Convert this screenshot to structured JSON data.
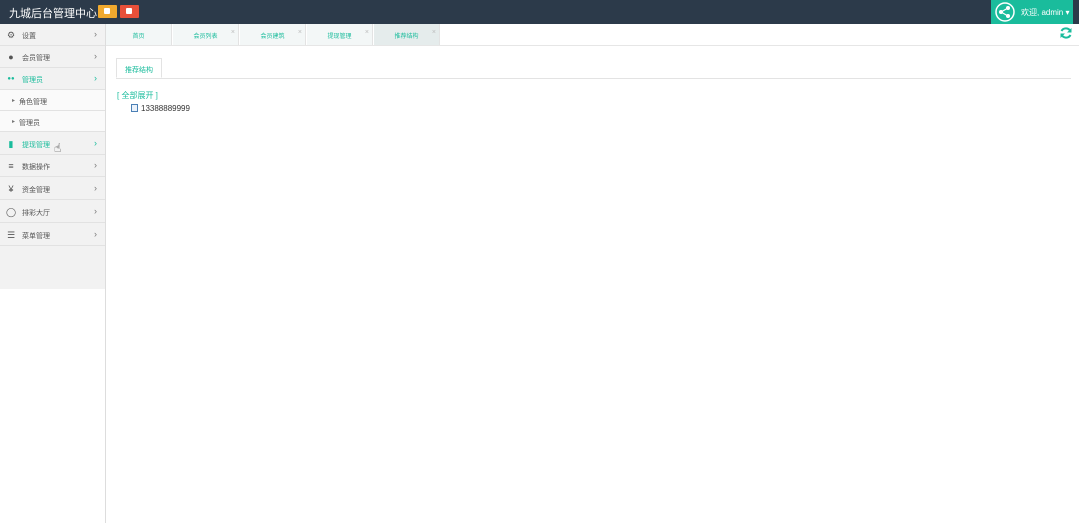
{
  "header": {
    "title": "九城后台管理中心",
    "welcome": "欢迎, admin ▾"
  },
  "sidebar": {
    "items": [
      {
        "label": "设置",
        "icon": "gears-icon",
        "glyph": "⚙"
      },
      {
        "label": "会员管理",
        "icon": "user-icon",
        "glyph": "●"
      },
      {
        "label": "管理员",
        "icon": "users-icon",
        "glyph": "●●"
      },
      {
        "label": "提现管理",
        "icon": "tablet-icon",
        "glyph": "▮"
      },
      {
        "label": "数据操作",
        "icon": "database-icon",
        "glyph": "≡"
      },
      {
        "label": "资金管理",
        "icon": "yen-icon",
        "glyph": "¥"
      },
      {
        "label": "排彩大厅",
        "icon": "circle-icon",
        "glyph": "◯"
      },
      {
        "label": "菜单管理",
        "icon": "list-icon",
        "glyph": "☰"
      }
    ],
    "subitems": [
      {
        "label": "角色管理"
      },
      {
        "label": "管理员"
      }
    ],
    "chevron": "›"
  },
  "tabs": [
    {
      "label": "首页"
    },
    {
      "label": "会员列表"
    },
    {
      "label": "会员建筑"
    },
    {
      "label": "提现管理"
    },
    {
      "label": "推荐结构"
    }
  ],
  "content": {
    "tab_label": "推荐结构",
    "expand_all": "[ 全部展开 ]",
    "tree_node": "13388889999"
  }
}
